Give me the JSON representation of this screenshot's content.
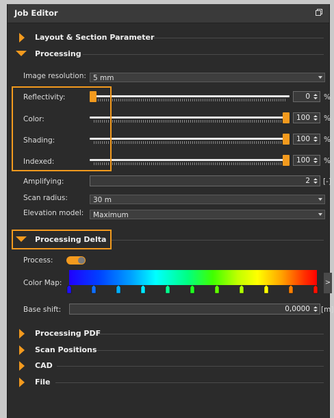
{
  "window": {
    "title": "Job Editor"
  },
  "sections": {
    "layout": "Layout & Section Parameter",
    "processing": "Processing",
    "processing_delta": "Processing Delta",
    "processing_pdf": "Processing PDF",
    "scan_positions": "Scan Positions",
    "cad": "CAD",
    "file": "File"
  },
  "processing": {
    "image_resolution": {
      "label": "Image resolution:",
      "value": "5 mm"
    },
    "reflectivity": {
      "label": "Reflectivity:",
      "value": "0",
      "unit": "%",
      "level": 0
    },
    "color": {
      "label": "Color:",
      "value": "100",
      "unit": "%",
      "level": 100
    },
    "shading": {
      "label": "Shading:",
      "value": "100",
      "unit": "%",
      "level": 100
    },
    "indexed": {
      "label": "Indexed:",
      "value": "100",
      "unit": "%",
      "level": 100
    },
    "amplifying": {
      "label": "Amplifying:",
      "value": "2",
      "unit": "[-]"
    },
    "scan_radius": {
      "label": "Scan radius:",
      "value": "30 m"
    },
    "elevation_model": {
      "label": "Elevation model:",
      "value": "Maximum"
    }
  },
  "delta": {
    "process": {
      "label": "Process:",
      "enabled": true
    },
    "color_map": {
      "label": "Color Map:",
      "more": ">"
    },
    "base_shift": {
      "label": "Base shift:",
      "value": "0,0000",
      "unit": "[m]"
    }
  },
  "colors": {
    "accent": "#f39a1e",
    "panel": "#2b2b2b",
    "highlight": "#f39a1e"
  }
}
